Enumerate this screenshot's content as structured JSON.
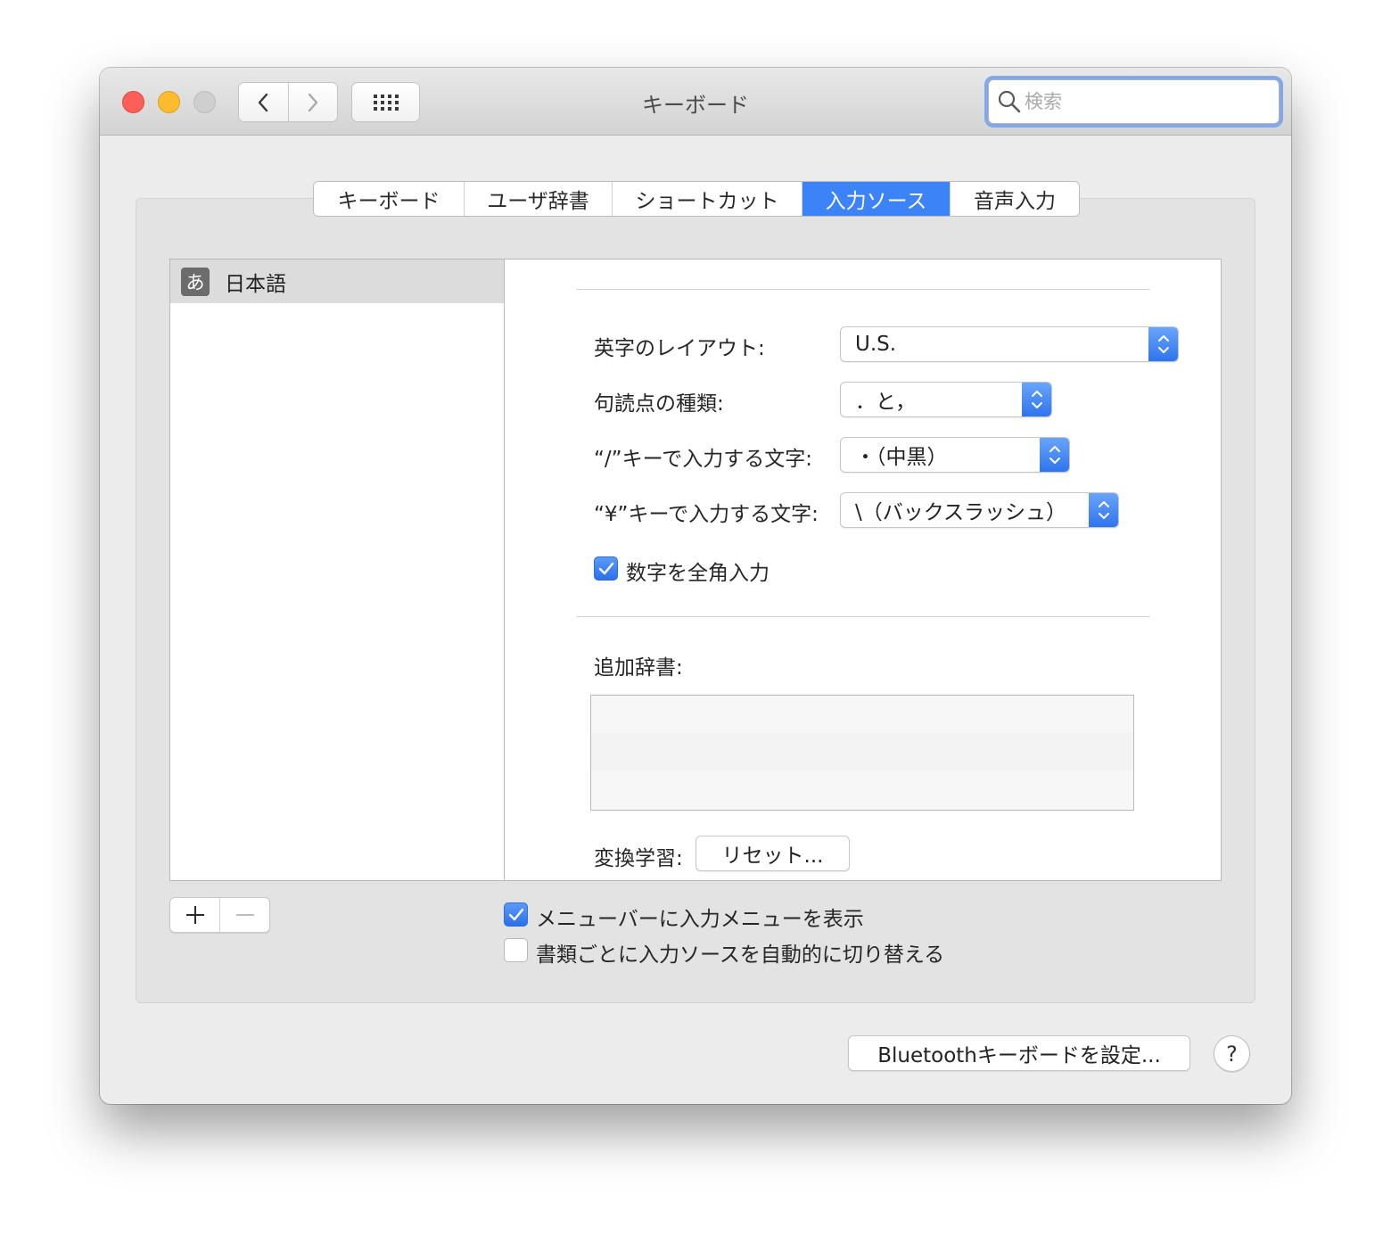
{
  "window": {
    "title": "キーボード"
  },
  "search": {
    "placeholder": "検索"
  },
  "tabs": [
    {
      "label": "キーボード"
    },
    {
      "label": "ユーザ辞書"
    },
    {
      "label": "ショートカット"
    },
    {
      "label": "入力ソース",
      "selected": true
    },
    {
      "label": "音声入力"
    }
  ],
  "sources": [
    {
      "icon": "あ",
      "label": "日本語",
      "selected": true
    }
  ],
  "settings": {
    "layout": {
      "label": "英字のレイアウト:",
      "value": "U.S."
    },
    "punctuation": {
      "label": "句読点の種類:",
      "value": "．と，"
    },
    "slash_key": {
      "label": "“/”キーで入力する文字:",
      "value": "・（中黒）"
    },
    "yen_key": {
      "label": "“¥”キーで入力する文字:",
      "value": "\\（バックスラッシュ）"
    },
    "fullwidth_numbers": {
      "label": "数字を全角入力",
      "checked": true
    },
    "extra_dictionary": {
      "label": "追加辞書:"
    },
    "learning": {
      "label": "変換学習:",
      "button": "リセット..."
    }
  },
  "options": {
    "show_input_menu": {
      "label": "メニューバーに入力メニューを表示",
      "checked": true
    },
    "auto_switch": {
      "label": "書類ごとに入力ソースを自動的に切り替える",
      "checked": false
    }
  },
  "footer": {
    "bluetooth_button": "Bluetoothキーボードを設定...",
    "help": "?"
  },
  "colors": {
    "accent": "#3b83f7",
    "close": "#fc5f57",
    "minimize": "#fdbc2e",
    "zoom_disabled": "#cfcfcf"
  }
}
